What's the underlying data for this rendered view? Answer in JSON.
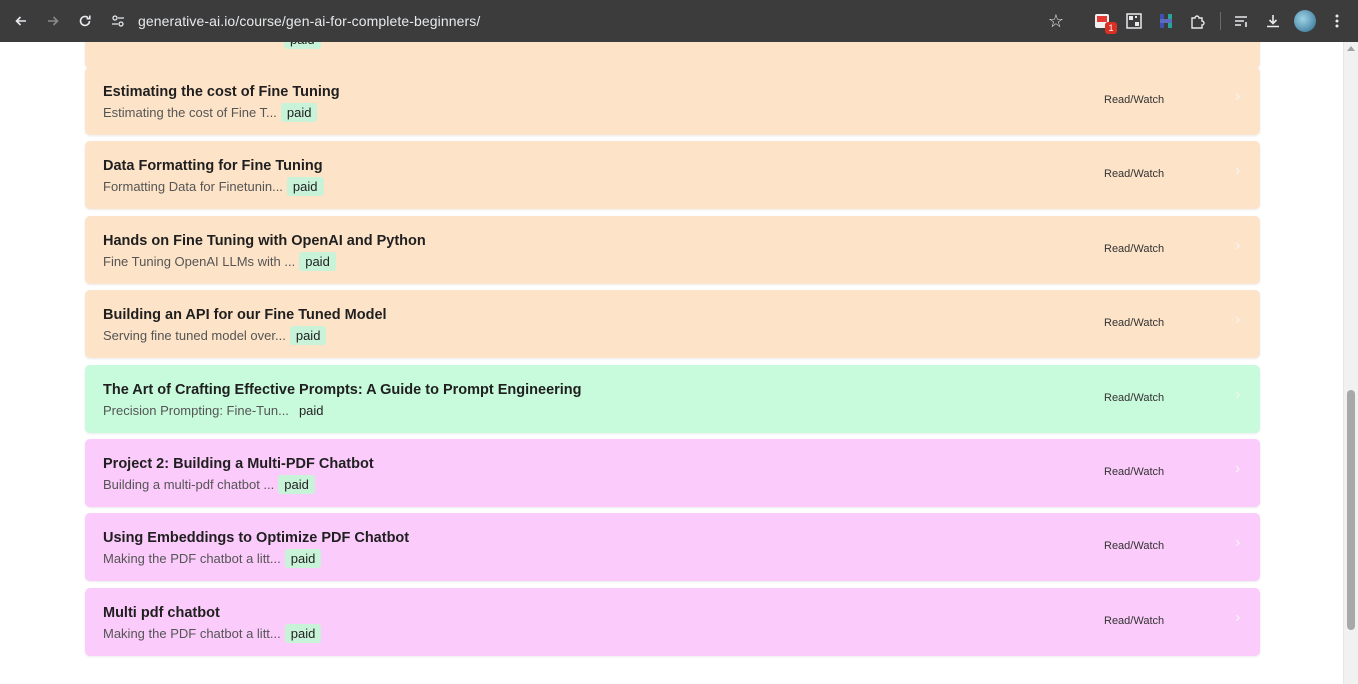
{
  "browser": {
    "url": "generative-ai.io/course/gen-ai-for-complete-beginners/",
    "extension_badge": "1",
    "icons": [
      "back-icon",
      "forward-icon",
      "reload-icon",
      "site-info-icon",
      "star-icon",
      "pdf-extension-icon",
      "qr-extension-icon",
      "hubspot-extension-icon",
      "puzzle-extensions-icon",
      "reading-list-icon",
      "download-icon",
      "profile-avatar",
      "kebab-menu-icon"
    ]
  },
  "lessons": [
    {
      "title": "Estimating the cost of Fine Tuning",
      "subtitle": "Estimating the cost of Fine T...",
      "tag": "paid",
      "action": "Read/Watch",
      "color": "#fde3c8"
    },
    {
      "title": "Data Formatting for Fine Tuning",
      "subtitle": "Formatting Data for Finetunin...",
      "tag": "paid",
      "action": "Read/Watch",
      "color": "#fde3c8"
    },
    {
      "title": "Hands on Fine Tuning with OpenAI and Python",
      "subtitle": "Fine Tuning OpenAI LLMs with ...",
      "tag": "paid",
      "action": "Read/Watch",
      "color": "#fde3c8"
    },
    {
      "title": "Building an API for our Fine Tuned Model",
      "subtitle": "Serving fine tuned model over...",
      "tag": "paid",
      "action": "Read/Watch",
      "color": "#fde3c8"
    },
    {
      "title": "The Art of Crafting Effective Prompts: A Guide to Prompt Engineering",
      "subtitle": "Precision Prompting: Fine-Tun...",
      "tag": "paid",
      "action": "Read/Watch",
      "color": "#c8fadc"
    },
    {
      "title": "Project 2: Building a Multi-PDF Chatbot",
      "subtitle": "Building a multi-pdf chatbot ...",
      "tag": "paid",
      "action": "Read/Watch",
      "color": "#fbcbfb"
    },
    {
      "title": "Using Embeddings to Optimize PDF Chatbot",
      "subtitle": "Making the PDF chatbot a litt...",
      "tag": "paid",
      "action": "Read/Watch",
      "color": "#fbcbfb"
    },
    {
      "title": "Multi pdf chatbot",
      "subtitle": "Making the PDF chatbot a litt...",
      "tag": "paid",
      "action": "Read/Watch",
      "color": "#fbcbfb"
    }
  ],
  "partial_lesson_tag": "paid"
}
